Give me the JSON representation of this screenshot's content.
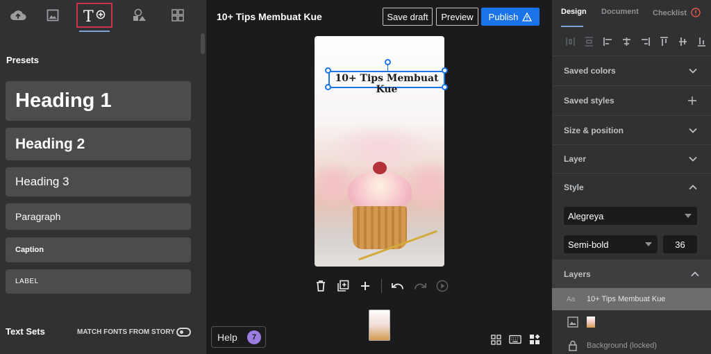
{
  "left_panel": {
    "tabs": [
      {
        "icon": "upload-cloud-icon"
      },
      {
        "icon": "image-icon"
      },
      {
        "icon": "text-add-icon",
        "active": true
      },
      {
        "icon": "shapes-icon"
      },
      {
        "icon": "grid-templates-icon"
      }
    ],
    "presets_title": "Presets",
    "presets": [
      "Heading 1",
      "Heading 2",
      "Heading 3",
      "Paragraph",
      "Caption",
      "LABEL"
    ],
    "text_sets_title": "Text Sets",
    "match_fonts_label": "MATCH FONTS FROM STORY"
  },
  "header": {
    "story_title": "10+ Tips Membuat Kue",
    "save_draft": "Save draft",
    "preview": "Preview",
    "publish": "Publish"
  },
  "canvas": {
    "selected_text": "10+ Tips Membuat Kue"
  },
  "help": {
    "label": "Help",
    "badge_count": "7"
  },
  "right_panel": {
    "tabs": {
      "design": "Design",
      "document": "Document",
      "checklist": "Checklist"
    },
    "sections": {
      "saved_colors": "Saved colors",
      "saved_styles": "Saved styles",
      "size_position": "Size & position",
      "layer": "Layer",
      "style": "Style"
    },
    "style": {
      "font": "Alegreya",
      "weight": "Semi-bold",
      "size": "36"
    },
    "layers": {
      "title": "Layers",
      "items": [
        {
          "icon_text": "Aa",
          "label": "10+ Tips Membuat Kue"
        },
        {
          "label": ""
        },
        {
          "label": "Background (locked)"
        }
      ]
    }
  },
  "colors": {
    "accent": "#1a73e8",
    "active_tab_border": "#d12f4c",
    "help_badge": "#9b7ce0",
    "checklist_alert": "#e8594b"
  }
}
